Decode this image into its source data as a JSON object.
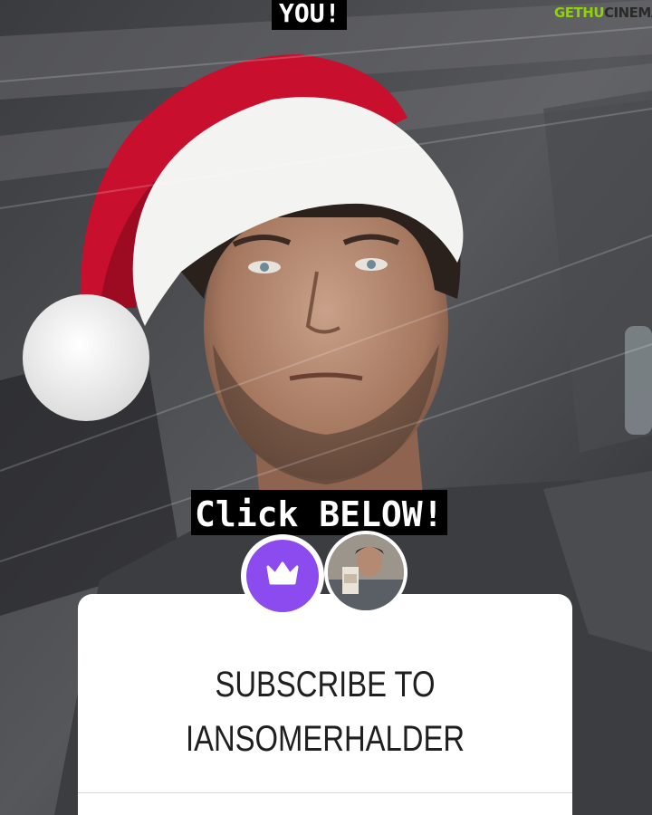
{
  "story": {
    "caption_top": "YOU!",
    "caption_click": "Click BELOW!",
    "watermark": {
      "part_a": "GETHU",
      "part_b": "CINEMA"
    }
  },
  "subscribe_card": {
    "line1": "SUBSCRIBE TO",
    "line2": "IANSOMERHALDER",
    "crown_badge_icon": "crown-icon",
    "badge_color": "#8c4bee"
  }
}
